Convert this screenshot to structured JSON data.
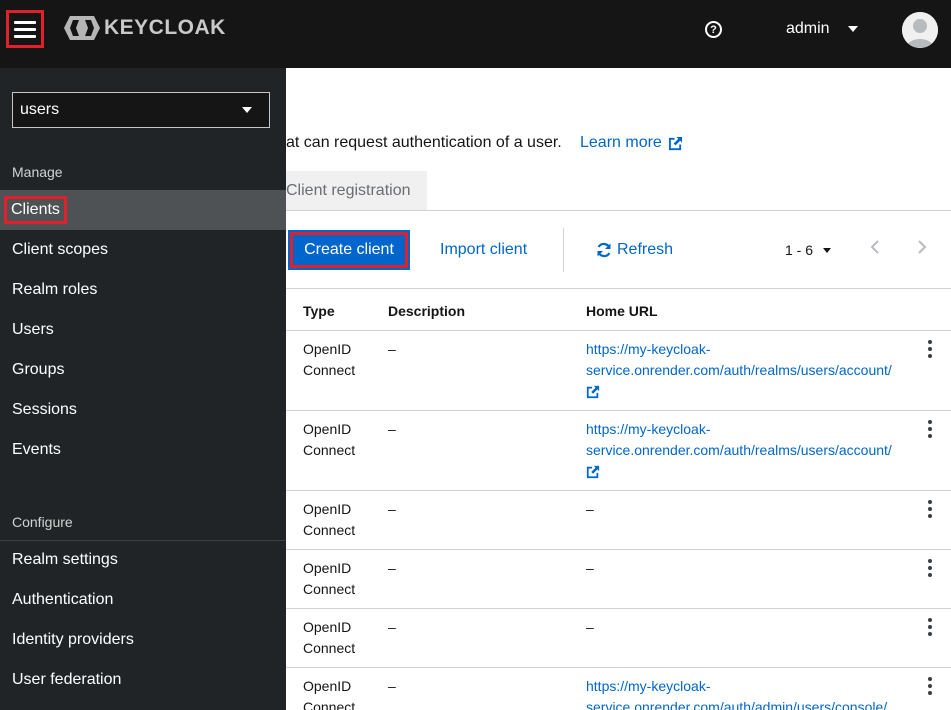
{
  "header": {
    "logo_text": "KEYCLOAK",
    "username": "admin",
    "icons": [
      "menu-icon",
      "help-icon",
      "caret-down-icon",
      "avatar-icon"
    ]
  },
  "sidebar": {
    "realm": "users",
    "manage_title": "Manage",
    "manage_items": [
      {
        "label": "Clients",
        "active": true
      },
      {
        "label": "Client scopes"
      },
      {
        "label": "Realm roles"
      },
      {
        "label": "Users"
      },
      {
        "label": "Groups"
      },
      {
        "label": "Sessions"
      },
      {
        "label": "Events"
      }
    ],
    "configure_title": "Configure",
    "configure_items": [
      {
        "label": "Realm settings"
      },
      {
        "label": "Authentication"
      },
      {
        "label": "Identity providers"
      },
      {
        "label": "User federation"
      }
    ]
  },
  "main": {
    "description": "at can request authentication of a user.",
    "learn_more": "Learn more",
    "tab_client_registration": "Client registration",
    "create_client": "Create client",
    "import_client": "Import client",
    "refresh": "Refresh",
    "pagination": "1 - 6",
    "table": {
      "headers": {
        "type": "Type",
        "description": "Description",
        "home_url": "Home URL"
      },
      "rows": [
        {
          "type": "OpenID Connect",
          "description": "–",
          "home_url": [
            "https://my-keycloak-",
            "service.onrender.com/auth/realms/users/account/"
          ],
          "external": true
        },
        {
          "type": "OpenID Connect",
          "description": "–",
          "home_url": [
            "https://my-keycloak-",
            "service.onrender.com/auth/realms/users/account/"
          ],
          "external": true
        },
        {
          "type": "OpenID Connect",
          "description": "–",
          "home_url_text": "–"
        },
        {
          "type": "OpenID Connect",
          "description": "–",
          "home_url_text": "–"
        },
        {
          "type": "OpenID Connect",
          "description": "–",
          "home_url_text": "–"
        },
        {
          "type": "OpenID Connect",
          "description": "–",
          "home_url": [
            "https://my-keycloak-",
            "service.onrender.com/auth/admin/users/console/"
          ],
          "external": false
        }
      ]
    }
  },
  "colors": {
    "accent": "#0066cc",
    "highlight": "#e0202a",
    "sidebar": "#212427",
    "masthead": "#151515"
  }
}
